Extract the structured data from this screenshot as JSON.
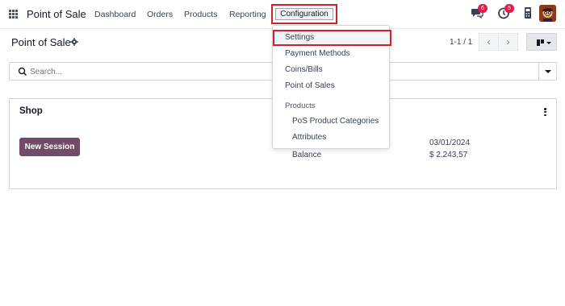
{
  "navbar": {
    "app_name": "Point of Sale",
    "menu": [
      "Dashboard",
      "Orders",
      "Products",
      "Reporting"
    ],
    "config_label": "Configuration",
    "chat_badge": "6",
    "activity_badge": "5"
  },
  "control_panel": {
    "title": "Point of Sale",
    "pager": "1-1 / 1",
    "search_placeholder": "Search..."
  },
  "card": {
    "title": "Shop",
    "button_label": "New Session",
    "balance_label": "Balance",
    "date": "03/01/2024",
    "balance_value": "$ 2.243,57"
  },
  "dropdown": {
    "items": [
      "Settings",
      "Payment Methods",
      "Coins/Bills",
      "Point of Sales"
    ],
    "section_header": "Products",
    "sub_items": [
      "PoS Product Categories",
      "Attributes"
    ]
  },
  "colors": {
    "accent": "#714b67",
    "highlight_border": "#d2202b",
    "badge": "#e11d48"
  },
  "icons": [
    "apps-icon",
    "chat-icon",
    "clock-icon",
    "phone-icon",
    "gear-icon",
    "search-icon",
    "chevron-left-icon",
    "chevron-right-icon",
    "kanban-view-icon",
    "kebab-icon"
  ]
}
